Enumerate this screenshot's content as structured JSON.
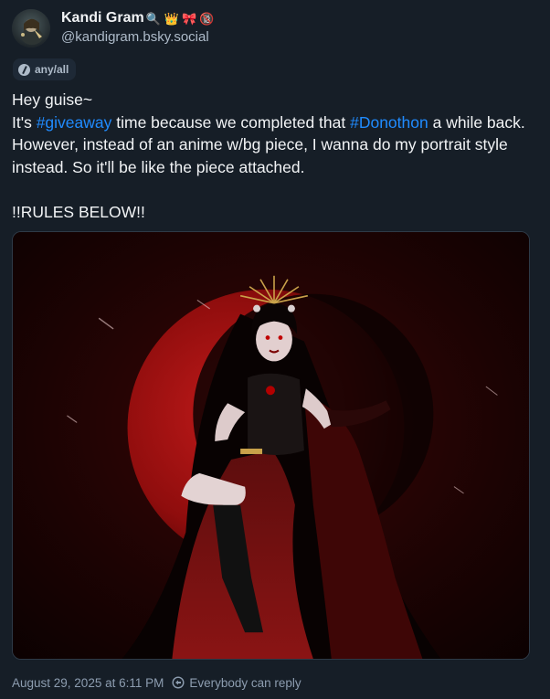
{
  "author": {
    "display_name": "Kandi Gram",
    "name_emojis": [
      "🔍",
      "👑",
      "🎀",
      "🔞"
    ],
    "handle": "@kandigram.bsky.social"
  },
  "feed_chip": {
    "label": "any/all",
    "icon": "feed-icon"
  },
  "post": {
    "line1": "Hey guise~",
    "line2_pre": "It's ",
    "tag1": "#giveaway",
    "line2_mid": " time because we completed that ",
    "tag2": "#Donothon",
    "line2_post": " a while back. However, instead of an anime w/bg piece, I wanna do my portrait style instead. So it'll be like the piece attached.",
    "rules": "!!RULES BELOW!!"
  },
  "meta": {
    "date": "August 29, 2025 at 6:11 PM",
    "reply_setting": "Everybody can reply",
    "reply_icon": "globe-reply-icon"
  },
  "colors": {
    "background": "#161e27",
    "text": "#f1f3f5",
    "muted": "#aebbc9",
    "link": "#208bfe"
  }
}
